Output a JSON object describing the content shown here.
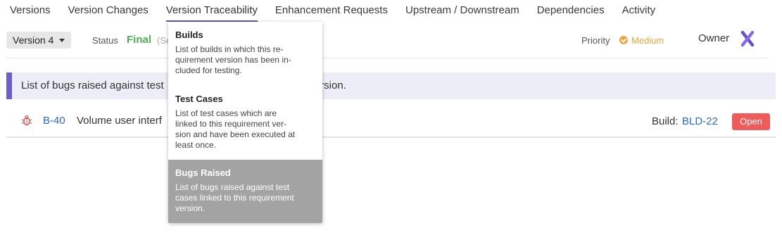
{
  "tabs": [
    {
      "label": "Versions"
    },
    {
      "label": "Version Changes"
    },
    {
      "label": "Version Traceability"
    },
    {
      "label": "Enhancement Requests"
    },
    {
      "label": "Upstream / Downstream"
    },
    {
      "label": "Dependencies"
    },
    {
      "label": "Activity"
    }
  ],
  "active_tab": "Version Traceability",
  "toolbar": {
    "version_label": "Version 4",
    "status_label": "Status",
    "status_value": "Final",
    "status_extra": "(Se",
    "priority_label": "Priority",
    "priority_value": "Medium",
    "owner_label": "Owner"
  },
  "banner": {
    "text_start": "List of bugs raised against test",
    "text_end": "nt version."
  },
  "bug": {
    "id": "B-40",
    "title": "Volume user interf",
    "build_label": "Build:",
    "build_value": "BLD-22",
    "status": "Open"
  },
  "dropdown": {
    "items": [
      {
        "title": "Builds",
        "desc_lines": [
          "List of builds in which this re-",
          "quirement version has been in-",
          "cluded for testing."
        ]
      },
      {
        "title": "Test Cases",
        "desc_lines": [
          "List of test cases which are",
          "linked to this requirement ver-",
          "sion and have been executed at",
          "least once."
        ]
      },
      {
        "title": "Bugs Raised",
        "desc_lines": [
          "List of bugs raised against test",
          "cases linked to this requirement",
          "version."
        ]
      }
    ],
    "highlighted": "Bugs Raised"
  },
  "colors": {
    "accent": "#5b5bc4",
    "status_final": "#4caf50",
    "priority_medium": "#f0a43a",
    "link": "#2a6ad0",
    "open_badge": "#ef5b5b",
    "banner_bg": "#ededf7",
    "banner_border": "#6a5fcf",
    "highlight_bg": "#a3a3a3"
  },
  "icons": {
    "caret": "chevron-down-icon",
    "priority": "priority-medium-icon",
    "owner": "x-avatar-icon",
    "bug": "bug-icon"
  }
}
